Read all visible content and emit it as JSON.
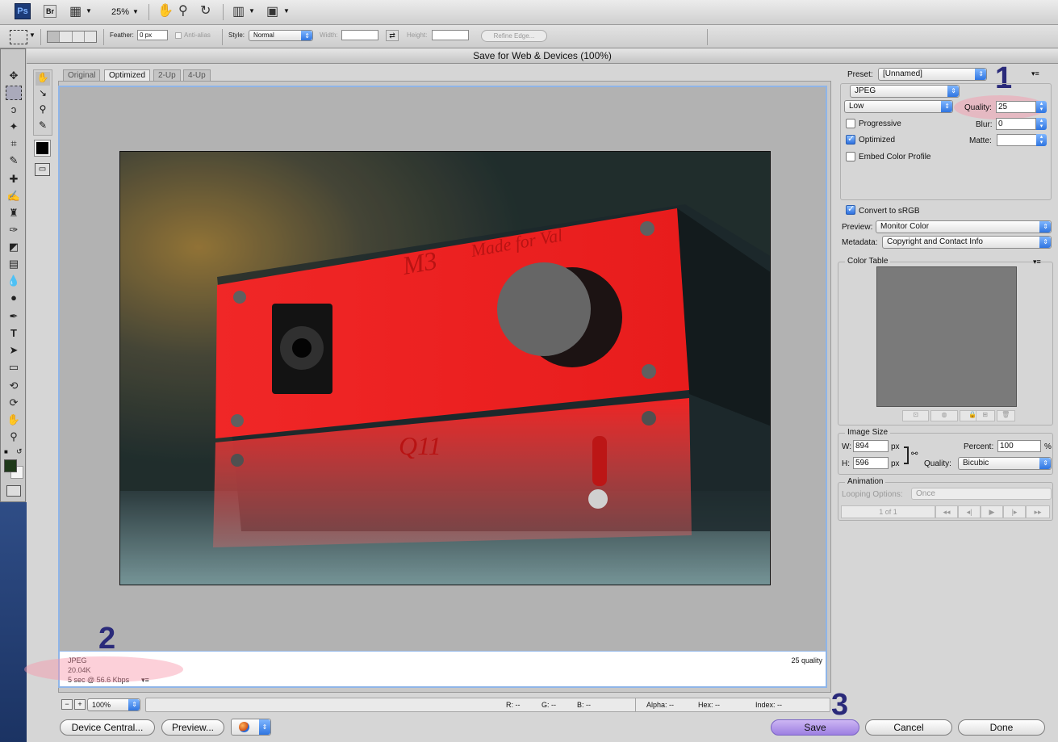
{
  "menubar": {
    "app_logo": "Ps",
    "bridge_logo": "Br",
    "zoom": "25%"
  },
  "options": {
    "feather_label": "Feather:",
    "feather_value": "0 px",
    "anti_alias": "Anti-alias",
    "style_label": "Style:",
    "style_value": "Normal",
    "width_label": "Width:",
    "height_label": "Height:",
    "refine_edge": "Refine Edge..."
  },
  "dialog": {
    "title": "Save for Web & Devices (100%)",
    "tabs": [
      "Original",
      "Optimized",
      "2-Up",
      "4-Up"
    ],
    "active_tab": "Optimized"
  },
  "image_info": {
    "format": "JPEG",
    "size": "20.04K",
    "download_time": "5 sec @ 56.6 Kbps",
    "quality_text": "25 quality"
  },
  "image_text": {
    "brand": "M3",
    "tagline": "Made for Val",
    "model": "Q11"
  },
  "annotations": {
    "one": "1",
    "two": "2",
    "three": "3"
  },
  "status_bar": {
    "zoom": "100%",
    "r": "R: --",
    "g": "G: --",
    "b": "B: --",
    "alpha": "Alpha: --",
    "hex": "Hex: --",
    "index": "Index: --"
  },
  "bottom_buttons": {
    "device_central": "Device Central...",
    "preview": "Preview...",
    "save": "Save",
    "cancel": "Cancel",
    "done": "Done"
  },
  "settings": {
    "preset_label": "Preset:",
    "preset_value": "[Unnamed]",
    "format": "JPEG",
    "quality_level": "Low",
    "quality_label": "Quality:",
    "quality_value": "25",
    "progressive_label": "Progressive",
    "progressive": false,
    "blur_label": "Blur:",
    "blur_value": "0",
    "optimized_label": "Optimized",
    "optimized": true,
    "matte_label": "Matte:",
    "embed_profile_label": "Embed Color Profile",
    "embed_profile": false,
    "convert_srgb_label": "Convert to sRGB",
    "convert_srgb": true,
    "preview_label": "Preview:",
    "preview_value": "Monitor Color",
    "metadata_label": "Metadata:",
    "metadata_value": "Copyright and Contact Info"
  },
  "color_table": {
    "title": "Color Table"
  },
  "image_size": {
    "title": "Image Size",
    "w_label": "W:",
    "w_value": "894",
    "h_label": "H:",
    "h_value": "596",
    "unit": "px",
    "percent_label": "Percent:",
    "percent_value": "100",
    "percent_unit": "%",
    "quality_label": "Quality:",
    "quality_value": "Bicubic"
  },
  "animation": {
    "title": "Animation",
    "looping_label": "Looping Options:",
    "looping_value": "Once",
    "frame": "1 of 1"
  }
}
